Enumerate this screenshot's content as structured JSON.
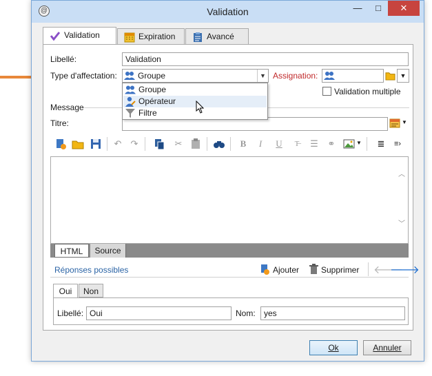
{
  "window": {
    "title": "Validation",
    "minimize": "—",
    "maximize": "□",
    "close": "✕"
  },
  "tabs": [
    {
      "label": "Validation",
      "icon": "check-icon",
      "active": true
    },
    {
      "label": "Expiration",
      "icon": "calendar-icon",
      "active": false
    },
    {
      "label": "Avancé",
      "icon": "clipboard-icon",
      "active": false
    }
  ],
  "form": {
    "libelle_label": "Libellé:",
    "libelle_value": "Validation",
    "type_label": "Type d'affectation:",
    "type_value": "Groupe",
    "assignation_label": "Assignation:",
    "validation_multiple": "Validation multiple",
    "message_label": "Message",
    "titre_label": "Titre:",
    "titre_value": ""
  },
  "dropdown": {
    "items": [
      {
        "label": "Groupe",
        "icon": "group-icon"
      },
      {
        "label": "Opérateur",
        "icon": "operator-icon",
        "hover": true
      },
      {
        "label": "Filtre",
        "icon": "filter-icon"
      }
    ]
  },
  "editor": {
    "tab_html": "HTML",
    "tab_source": "Source"
  },
  "responses": {
    "title": "Réponses possibles",
    "add": "Ajouter",
    "delete": "Supprimer",
    "tabs": [
      "Oui",
      "Non"
    ],
    "libelle_label": "Libellé:",
    "libelle_value": "Oui",
    "nom_label": "Nom:",
    "nom_value": "yes"
  },
  "footer": {
    "ok": "Ok",
    "cancel": "Annuler"
  },
  "colors": {
    "accent_arrow": "#e8883a",
    "required_label": "#c0282a",
    "link_blue": "#2a63a5"
  }
}
